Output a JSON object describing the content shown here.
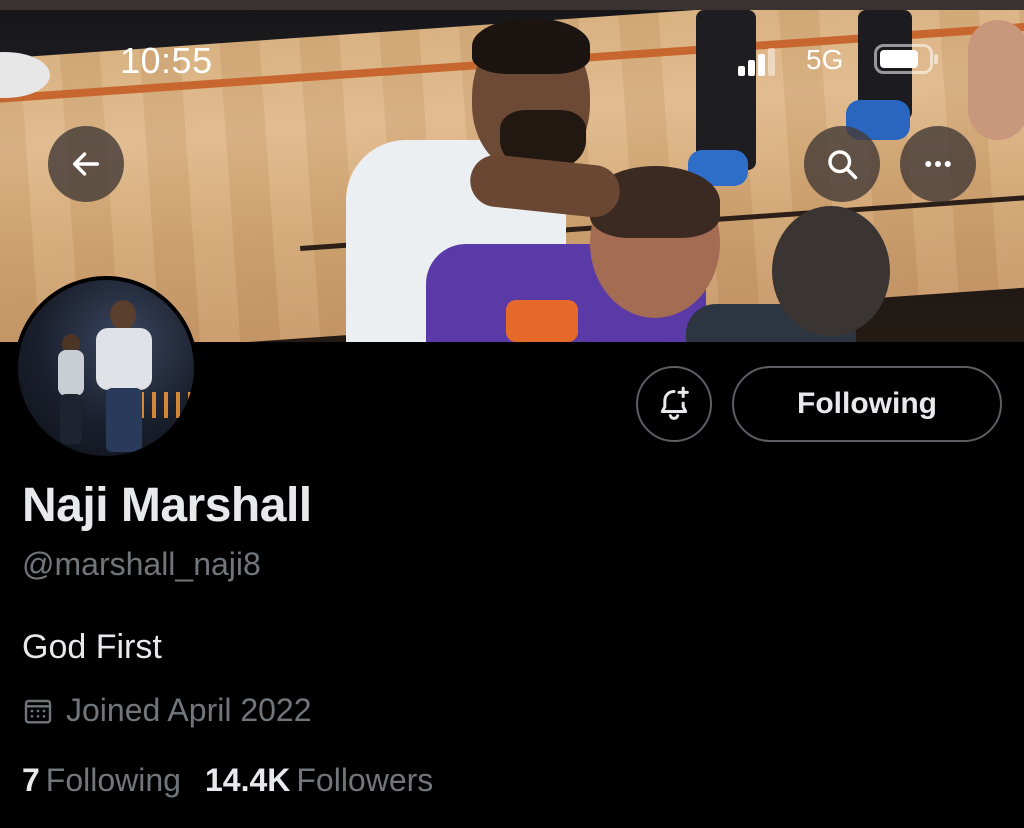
{
  "status_bar": {
    "time": "10:55",
    "network": "5G"
  },
  "header": {
    "back_icon": "arrow-left-icon",
    "search_icon": "search-icon",
    "more_icon": "more-horizontal-icon"
  },
  "profile": {
    "display_name": "Naji Marshall",
    "handle": "@marshall_naji8",
    "bio": "God First",
    "joined": "Joined April 2022",
    "following_count": "7",
    "following_label": "Following",
    "followers_count": "14.4K",
    "followers_label": "Followers"
  },
  "actions": {
    "notify_icon": "bell-plus-icon",
    "following_button_label": "Following"
  },
  "colors": {
    "background": "#000000",
    "text_primary": "#e7e9ea",
    "text_secondary": "#71767b",
    "button_border": "#5b5f63"
  }
}
